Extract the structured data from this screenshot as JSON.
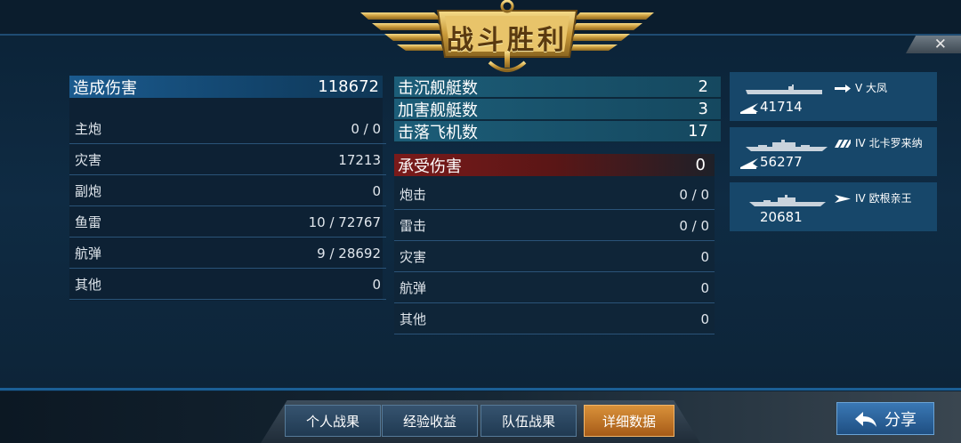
{
  "banner": {
    "title": "战斗胜利"
  },
  "close": {
    "glyph": "✕"
  },
  "damage_dealt": {
    "label": "造成伤害",
    "value": "118672",
    "rows": [
      {
        "label": "主炮",
        "value": "0 / 0"
      },
      {
        "label": "灾害",
        "value": "17213"
      },
      {
        "label": "副炮",
        "value": "0"
      },
      {
        "label": "鱼雷",
        "value": "10 / 72767"
      },
      {
        "label": "航弹",
        "value": "9 / 28692"
      },
      {
        "label": "其他",
        "value": "0"
      }
    ]
  },
  "combat": {
    "rows": [
      {
        "label": "击沉舰艇数",
        "value": "2"
      },
      {
        "label": "加害舰艇数",
        "value": "3"
      },
      {
        "label": "击落飞机数",
        "value": "17"
      }
    ]
  },
  "damage_taken": {
    "label": "承受伤害",
    "value": "0",
    "rows": [
      {
        "label": "炮击",
        "value": "0 / 0"
      },
      {
        "label": "雷击",
        "value": "0 / 0"
      },
      {
        "label": "灾害",
        "value": "0"
      },
      {
        "label": "航弹",
        "value": "0"
      },
      {
        "label": "其他",
        "value": "0"
      }
    ]
  },
  "ships": [
    {
      "tier": "V",
      "name": "大凤",
      "damage": "41714",
      "class_icon": "carrier-class-icon",
      "has_plane": true
    },
    {
      "tier": "IV",
      "name": "北卡罗来纳",
      "damage": "56277",
      "class_icon": "battleship-class-icon",
      "has_plane": true
    },
    {
      "tier": "IV",
      "name": "欧根亲王",
      "damage": "20681",
      "class_icon": "cruiser-class-icon",
      "has_plane": false
    }
  ],
  "tabs": [
    {
      "label": "个人战果",
      "active": false
    },
    {
      "label": "经验收益",
      "active": false
    },
    {
      "label": "队伍战果",
      "active": false
    },
    {
      "label": "详细数据",
      "active": true
    }
  ],
  "share": {
    "label": "分享"
  },
  "colors": {
    "gold": "#c99a3a",
    "active_tab": "#d9913a",
    "header_blue": "#1b5b8f",
    "header_red": "#7a1a1a"
  }
}
